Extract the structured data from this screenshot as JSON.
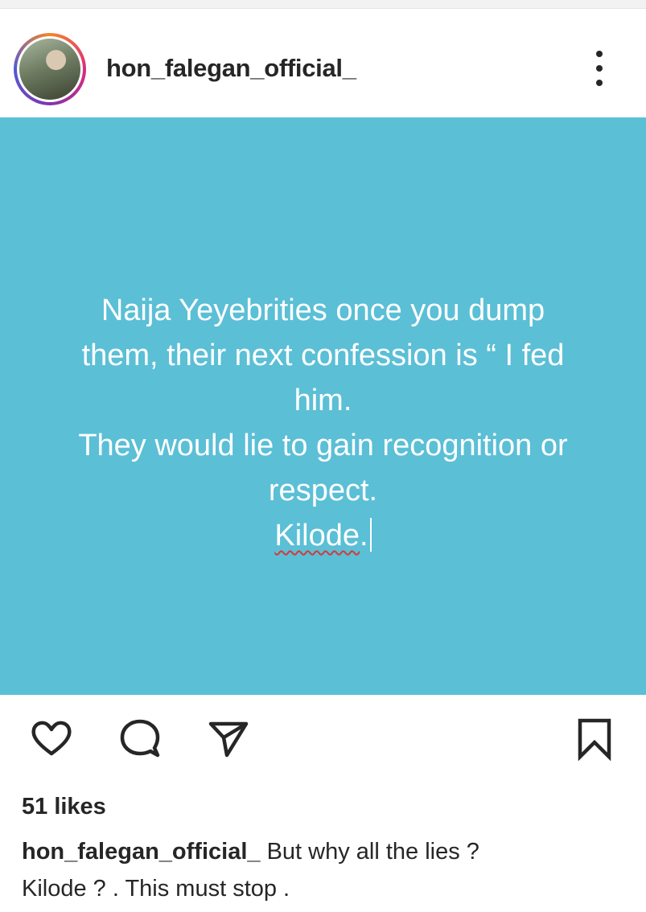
{
  "header": {
    "username": "hon_falegan_official_",
    "more_icon": "more-vertical-icon"
  },
  "post": {
    "background": "#5bbfd6",
    "lines": [
      "Naija Yeyebrities once you dump",
      "them, their next confession is “ I fed",
      "him.",
      "They would lie to gain recognition or",
      "respect."
    ],
    "last_word": "Kilode",
    "last_punct": "."
  },
  "actions": {
    "like_icon": "heart-icon",
    "comment_icon": "comment-icon",
    "share_icon": "send-icon",
    "save_icon": "bookmark-icon"
  },
  "likes": "51 likes",
  "caption": {
    "username": "hon_falegan_official_",
    "text_line1": " But why all the lies ?",
    "text_line2": "Kilode ? . This must stop ."
  }
}
